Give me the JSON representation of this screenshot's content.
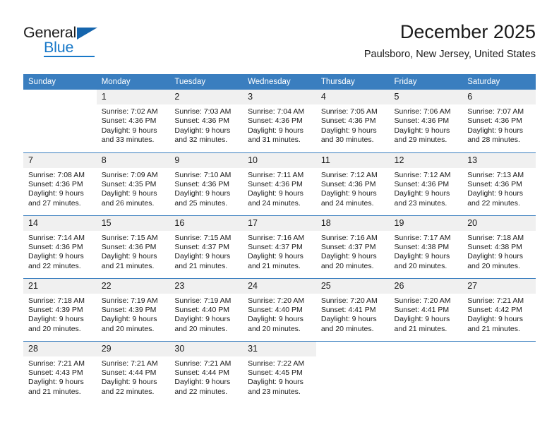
{
  "brand": {
    "name_part1": "General",
    "name_part2": "Blue",
    "triangle_color": "#1565ad",
    "blue_color": "#1878c8"
  },
  "header": {
    "title": "December 2025",
    "location": "Paulsboro, New Jersey, United States"
  },
  "calendar": {
    "header_bg": "#3a7ebf",
    "daynum_bg": "#f0f0f0",
    "weekdays": [
      "Sunday",
      "Monday",
      "Tuesday",
      "Wednesday",
      "Thursday",
      "Friday",
      "Saturday"
    ],
    "weeks": [
      [
        {
          "day": "",
          "sunrise": "",
          "sunset": "",
          "daylight1": "",
          "daylight2": ""
        },
        {
          "day": "1",
          "sunrise": "Sunrise: 7:02 AM",
          "sunset": "Sunset: 4:36 PM",
          "daylight1": "Daylight: 9 hours",
          "daylight2": "and 33 minutes."
        },
        {
          "day": "2",
          "sunrise": "Sunrise: 7:03 AM",
          "sunset": "Sunset: 4:36 PM",
          "daylight1": "Daylight: 9 hours",
          "daylight2": "and 32 minutes."
        },
        {
          "day": "3",
          "sunrise": "Sunrise: 7:04 AM",
          "sunset": "Sunset: 4:36 PM",
          "daylight1": "Daylight: 9 hours",
          "daylight2": "and 31 minutes."
        },
        {
          "day": "4",
          "sunrise": "Sunrise: 7:05 AM",
          "sunset": "Sunset: 4:36 PM",
          "daylight1": "Daylight: 9 hours",
          "daylight2": "and 30 minutes."
        },
        {
          "day": "5",
          "sunrise": "Sunrise: 7:06 AM",
          "sunset": "Sunset: 4:36 PM",
          "daylight1": "Daylight: 9 hours",
          "daylight2": "and 29 minutes."
        },
        {
          "day": "6",
          "sunrise": "Sunrise: 7:07 AM",
          "sunset": "Sunset: 4:36 PM",
          "daylight1": "Daylight: 9 hours",
          "daylight2": "and 28 minutes."
        }
      ],
      [
        {
          "day": "7",
          "sunrise": "Sunrise: 7:08 AM",
          "sunset": "Sunset: 4:36 PM",
          "daylight1": "Daylight: 9 hours",
          "daylight2": "and 27 minutes."
        },
        {
          "day": "8",
          "sunrise": "Sunrise: 7:09 AM",
          "sunset": "Sunset: 4:35 PM",
          "daylight1": "Daylight: 9 hours",
          "daylight2": "and 26 minutes."
        },
        {
          "day": "9",
          "sunrise": "Sunrise: 7:10 AM",
          "sunset": "Sunset: 4:36 PM",
          "daylight1": "Daylight: 9 hours",
          "daylight2": "and 25 minutes."
        },
        {
          "day": "10",
          "sunrise": "Sunrise: 7:11 AM",
          "sunset": "Sunset: 4:36 PM",
          "daylight1": "Daylight: 9 hours",
          "daylight2": "and 24 minutes."
        },
        {
          "day": "11",
          "sunrise": "Sunrise: 7:12 AM",
          "sunset": "Sunset: 4:36 PM",
          "daylight1": "Daylight: 9 hours",
          "daylight2": "and 24 minutes."
        },
        {
          "day": "12",
          "sunrise": "Sunrise: 7:12 AM",
          "sunset": "Sunset: 4:36 PM",
          "daylight1": "Daylight: 9 hours",
          "daylight2": "and 23 minutes."
        },
        {
          "day": "13",
          "sunrise": "Sunrise: 7:13 AM",
          "sunset": "Sunset: 4:36 PM",
          "daylight1": "Daylight: 9 hours",
          "daylight2": "and 22 minutes."
        }
      ],
      [
        {
          "day": "14",
          "sunrise": "Sunrise: 7:14 AM",
          "sunset": "Sunset: 4:36 PM",
          "daylight1": "Daylight: 9 hours",
          "daylight2": "and 22 minutes."
        },
        {
          "day": "15",
          "sunrise": "Sunrise: 7:15 AM",
          "sunset": "Sunset: 4:36 PM",
          "daylight1": "Daylight: 9 hours",
          "daylight2": "and 21 minutes."
        },
        {
          "day": "16",
          "sunrise": "Sunrise: 7:15 AM",
          "sunset": "Sunset: 4:37 PM",
          "daylight1": "Daylight: 9 hours",
          "daylight2": "and 21 minutes."
        },
        {
          "day": "17",
          "sunrise": "Sunrise: 7:16 AM",
          "sunset": "Sunset: 4:37 PM",
          "daylight1": "Daylight: 9 hours",
          "daylight2": "and 21 minutes."
        },
        {
          "day": "18",
          "sunrise": "Sunrise: 7:16 AM",
          "sunset": "Sunset: 4:37 PM",
          "daylight1": "Daylight: 9 hours",
          "daylight2": "and 20 minutes."
        },
        {
          "day": "19",
          "sunrise": "Sunrise: 7:17 AM",
          "sunset": "Sunset: 4:38 PM",
          "daylight1": "Daylight: 9 hours",
          "daylight2": "and 20 minutes."
        },
        {
          "day": "20",
          "sunrise": "Sunrise: 7:18 AM",
          "sunset": "Sunset: 4:38 PM",
          "daylight1": "Daylight: 9 hours",
          "daylight2": "and 20 minutes."
        }
      ],
      [
        {
          "day": "21",
          "sunrise": "Sunrise: 7:18 AM",
          "sunset": "Sunset: 4:39 PM",
          "daylight1": "Daylight: 9 hours",
          "daylight2": "and 20 minutes."
        },
        {
          "day": "22",
          "sunrise": "Sunrise: 7:19 AM",
          "sunset": "Sunset: 4:39 PM",
          "daylight1": "Daylight: 9 hours",
          "daylight2": "and 20 minutes."
        },
        {
          "day": "23",
          "sunrise": "Sunrise: 7:19 AM",
          "sunset": "Sunset: 4:40 PM",
          "daylight1": "Daylight: 9 hours",
          "daylight2": "and 20 minutes."
        },
        {
          "day": "24",
          "sunrise": "Sunrise: 7:20 AM",
          "sunset": "Sunset: 4:40 PM",
          "daylight1": "Daylight: 9 hours",
          "daylight2": "and 20 minutes."
        },
        {
          "day": "25",
          "sunrise": "Sunrise: 7:20 AM",
          "sunset": "Sunset: 4:41 PM",
          "daylight1": "Daylight: 9 hours",
          "daylight2": "and 20 minutes."
        },
        {
          "day": "26",
          "sunrise": "Sunrise: 7:20 AM",
          "sunset": "Sunset: 4:41 PM",
          "daylight1": "Daylight: 9 hours",
          "daylight2": "and 21 minutes."
        },
        {
          "day": "27",
          "sunrise": "Sunrise: 7:21 AM",
          "sunset": "Sunset: 4:42 PM",
          "daylight1": "Daylight: 9 hours",
          "daylight2": "and 21 minutes."
        }
      ],
      [
        {
          "day": "28",
          "sunrise": "Sunrise: 7:21 AM",
          "sunset": "Sunset: 4:43 PM",
          "daylight1": "Daylight: 9 hours",
          "daylight2": "and 21 minutes."
        },
        {
          "day": "29",
          "sunrise": "Sunrise: 7:21 AM",
          "sunset": "Sunset: 4:44 PM",
          "daylight1": "Daylight: 9 hours",
          "daylight2": "and 22 minutes."
        },
        {
          "day": "30",
          "sunrise": "Sunrise: 7:21 AM",
          "sunset": "Sunset: 4:44 PM",
          "daylight1": "Daylight: 9 hours",
          "daylight2": "and 22 minutes."
        },
        {
          "day": "31",
          "sunrise": "Sunrise: 7:22 AM",
          "sunset": "Sunset: 4:45 PM",
          "daylight1": "Daylight: 9 hours",
          "daylight2": "and 23 minutes."
        },
        {
          "day": "",
          "sunrise": "",
          "sunset": "",
          "daylight1": "",
          "daylight2": ""
        },
        {
          "day": "",
          "sunrise": "",
          "sunset": "",
          "daylight1": "",
          "daylight2": ""
        },
        {
          "day": "",
          "sunrise": "",
          "sunset": "",
          "daylight1": "",
          "daylight2": ""
        }
      ]
    ]
  }
}
